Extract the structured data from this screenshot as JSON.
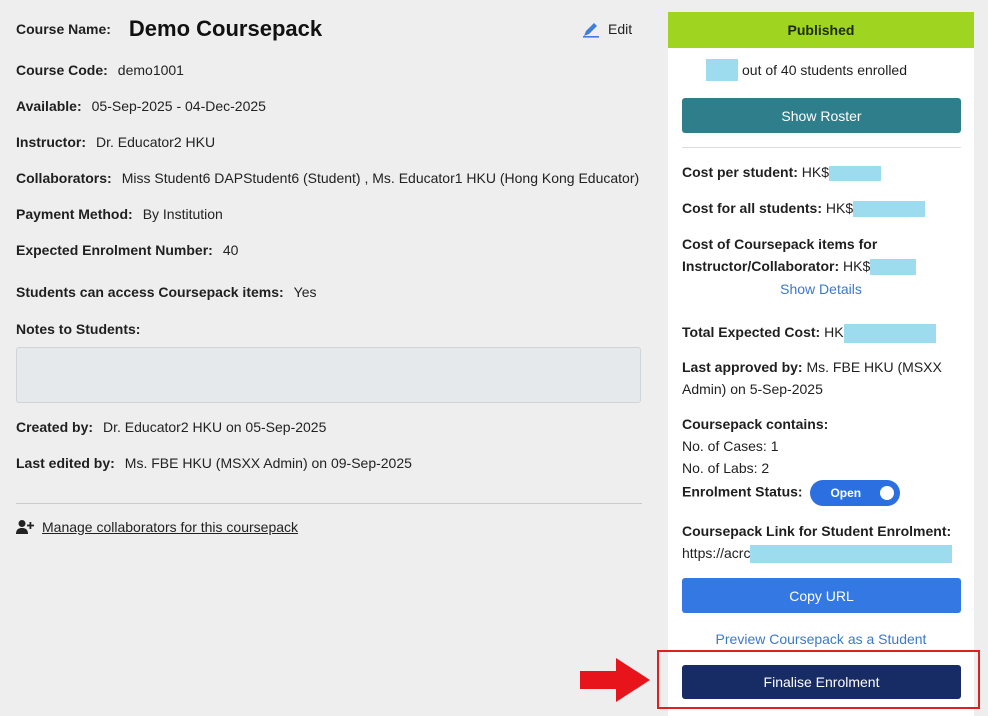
{
  "course": {
    "name_label": "Course Name:",
    "name": "Demo Coursepack",
    "edit_label": "Edit",
    "code_label": "Course Code:",
    "code": "demo1001",
    "available_label": "Available:",
    "available": "05-Sep-2025 - 04-Dec-2025",
    "instructor_label": "Instructor:",
    "instructor": "Dr. Educator2 HKU",
    "collaborators_label": "Collaborators:",
    "collaborators": "Miss Student6 DAPStudent6 (Student) , Ms. Educator1 HKU (Hong Kong Educator)",
    "payment_label": "Payment Method:",
    "payment": "By Institution",
    "expected_label": "Expected Enrolment Number:",
    "expected": "40",
    "access_label": "Students can access Coursepack items:",
    "access": "Yes",
    "notes_label": "Notes to Students:",
    "notes": "",
    "created_label": "Created by:",
    "created": "Dr. Educator2 HKU on 05-Sep-2025",
    "edited_label": "Last edited by:",
    "edited": "Ms. FBE HKU (MSXX Admin) on 09-Sep-2025",
    "manage_label": "Manage collaborators for this coursepack"
  },
  "panel": {
    "status": "Published",
    "enrolled_text": "out of 40 students enrolled",
    "show_roster": "Show Roster",
    "cost_student_label": "Cost per student:",
    "cost_student_prefix": "HK$",
    "cost_all_label": "Cost for all students:",
    "cost_all_prefix": "HK$",
    "cost_items_label": "Cost of Coursepack items for Instructor/Collaborator:",
    "cost_items_prefix": "HK$",
    "show_details": "Show Details",
    "total_label": "Total Expected Cost:",
    "total_prefix": "HK",
    "approved_label": "Last approved by:",
    "approved": "Ms. FBE HKU (MSXX Admin) on 5-Sep-2025",
    "contains_label": "Coursepack contains:",
    "cases": "No. of Cases: 1",
    "labs": "No. of Labs: 2",
    "enrol_status_label": "Enrolment Status:",
    "enrol_status": "Open",
    "link_label": "Coursepack Link for Student Enrolment:",
    "link_prefix": "https://acrc",
    "copy_url": "Copy URL",
    "preview": "Preview Coursepack as a Student",
    "finalise": "Finalise Enrolment"
  },
  "colors": {
    "published": "#9fd421",
    "roster": "#2e7e8c",
    "copy": "#3479e3",
    "finalise": "#172b65",
    "highlight": "#e02020",
    "redaction": "#9ddcee"
  },
  "icons": [
    "pencil-icon",
    "add-user-icon",
    "arrow-right-icon"
  ]
}
